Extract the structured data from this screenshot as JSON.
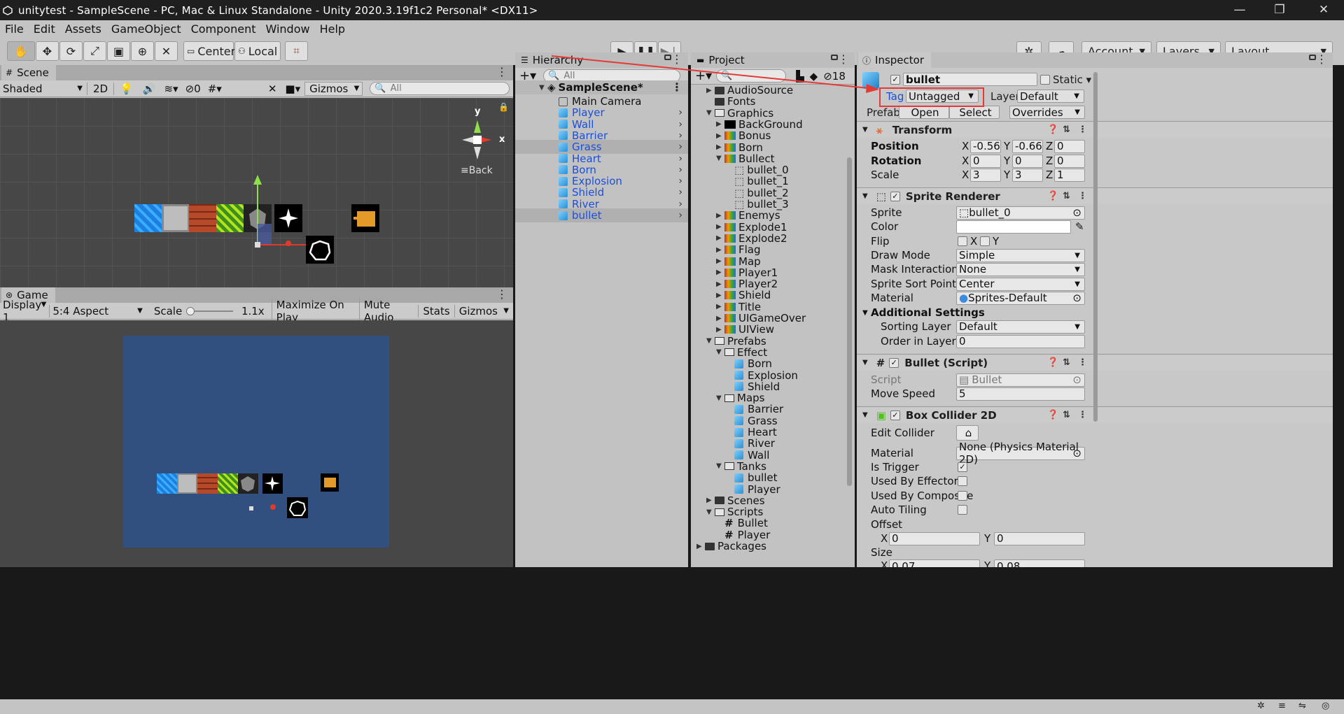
{
  "window": {
    "title": "unitytest - SampleScene - PC, Mac & Linux Standalone - Unity 2020.3.19f1c2 Personal* <DX11>"
  },
  "menu": [
    "File",
    "Edit",
    "Assets",
    "GameObject",
    "Component",
    "Window",
    "Help"
  ],
  "toolbar": {
    "center": "Center",
    "local": "Local",
    "account": "Account",
    "layers": "Layers",
    "layout": "Layout"
  },
  "scene": {
    "tab": "Scene",
    "shading": "Shaded",
    "mode2d": "2D",
    "hidden_count": "0",
    "gizmos": "Gizmos",
    "search_placeholder": "All",
    "gizmo_back": "Back",
    "axis_x": "x",
    "axis_y": "y"
  },
  "game": {
    "tab": "Game",
    "display": "Display 1",
    "aspect": "5:4 Aspect",
    "scale_label": "Scale",
    "scale_value": "1.1x",
    "maximize": "Maximize On Play",
    "mute": "Mute Audio",
    "stats": "Stats",
    "gizmos": "Gizmos"
  },
  "hierarchy": {
    "tab": "Hierarchy",
    "search_placeholder": "All",
    "scene": "SampleScene*",
    "items": [
      {
        "label": "Main Camera",
        "prefab": false
      },
      {
        "label": "Player",
        "prefab": true
      },
      {
        "label": "Wall",
        "prefab": true
      },
      {
        "label": "Barrier",
        "prefab": true
      },
      {
        "label": "Grass",
        "prefab": true
      },
      {
        "label": "Heart",
        "prefab": true
      },
      {
        "label": "Born",
        "prefab": true
      },
      {
        "label": "Explosion",
        "prefab": true
      },
      {
        "label": "Shield",
        "prefab": true
      },
      {
        "label": "River",
        "prefab": true
      },
      {
        "label": "bullet",
        "prefab": true
      }
    ]
  },
  "project": {
    "tab": "Project",
    "hidden_count": "18",
    "items": [
      {
        "label": "AudioSource",
        "depth": 1,
        "kind": "folder",
        "exp": "closed"
      },
      {
        "label": "Fonts",
        "depth": 1,
        "kind": "folder",
        "exp": "none"
      },
      {
        "label": "Graphics",
        "depth": 1,
        "kind": "folder",
        "exp": "open"
      },
      {
        "label": "BackGround",
        "depth": 2,
        "kind": "sprite",
        "exp": "closed"
      },
      {
        "label": "Bonus",
        "depth": 2,
        "kind": "sprite",
        "exp": "closed"
      },
      {
        "label": "Born",
        "depth": 2,
        "kind": "sprite",
        "exp": "closed"
      },
      {
        "label": "Bullect",
        "depth": 2,
        "kind": "sprite",
        "exp": "open"
      },
      {
        "label": "bullet_0",
        "depth": 3,
        "kind": "sub",
        "exp": "none"
      },
      {
        "label": "bullet_1",
        "depth": 3,
        "kind": "sub",
        "exp": "none"
      },
      {
        "label": "bullet_2",
        "depth": 3,
        "kind": "sub",
        "exp": "none"
      },
      {
        "label": "bullet_3",
        "depth": 3,
        "kind": "sub",
        "exp": "none"
      },
      {
        "label": "Enemys",
        "depth": 2,
        "kind": "sprite",
        "exp": "closed"
      },
      {
        "label": "Explode1",
        "depth": 2,
        "kind": "sprite",
        "exp": "closed"
      },
      {
        "label": "Explode2",
        "depth": 2,
        "kind": "sprite",
        "exp": "closed"
      },
      {
        "label": "Flag",
        "depth": 2,
        "kind": "sprite",
        "exp": "closed"
      },
      {
        "label": "Map",
        "depth": 2,
        "kind": "sprite",
        "exp": "closed"
      },
      {
        "label": "Player1",
        "depth": 2,
        "kind": "sprite",
        "exp": "closed"
      },
      {
        "label": "Player2",
        "depth": 2,
        "kind": "sprite",
        "exp": "closed"
      },
      {
        "label": "Shield",
        "depth": 2,
        "kind": "sprite",
        "exp": "closed"
      },
      {
        "label": "Title",
        "depth": 2,
        "kind": "sprite",
        "exp": "closed"
      },
      {
        "label": "UIGameOver",
        "depth": 2,
        "kind": "sprite",
        "exp": "closed"
      },
      {
        "label": "UIView",
        "depth": 2,
        "kind": "sprite",
        "exp": "closed"
      },
      {
        "label": "Prefabs",
        "depth": 1,
        "kind": "folder",
        "exp": "open"
      },
      {
        "label": "Effect",
        "depth": 2,
        "kind": "folder",
        "exp": "open"
      },
      {
        "label": "Born",
        "depth": 3,
        "kind": "prefab",
        "exp": "none"
      },
      {
        "label": "Explosion",
        "depth": 3,
        "kind": "prefab",
        "exp": "none"
      },
      {
        "label": "Shield",
        "depth": 3,
        "kind": "prefab",
        "exp": "none"
      },
      {
        "label": "Maps",
        "depth": 2,
        "kind": "folder",
        "exp": "open"
      },
      {
        "label": "Barrier",
        "depth": 3,
        "kind": "prefab",
        "exp": "none"
      },
      {
        "label": "Grass",
        "depth": 3,
        "kind": "prefab",
        "exp": "none"
      },
      {
        "label": "Heart",
        "depth": 3,
        "kind": "prefab",
        "exp": "none"
      },
      {
        "label": "River",
        "depth": 3,
        "kind": "prefab",
        "exp": "none"
      },
      {
        "label": "Wall",
        "depth": 3,
        "kind": "prefab",
        "exp": "none"
      },
      {
        "label": "Tanks",
        "depth": 2,
        "kind": "folder",
        "exp": "open"
      },
      {
        "label": "bullet",
        "depth": 3,
        "kind": "prefab",
        "exp": "none"
      },
      {
        "label": "Player",
        "depth": 3,
        "kind": "prefab",
        "exp": "none"
      },
      {
        "label": "Scenes",
        "depth": 1,
        "kind": "folder",
        "exp": "closed"
      },
      {
        "label": "Scripts",
        "depth": 1,
        "kind": "folder",
        "exp": "open"
      },
      {
        "label": "Bullet",
        "depth": 2,
        "kind": "script",
        "exp": "none"
      },
      {
        "label": "Player",
        "depth": 2,
        "kind": "script",
        "exp": "none"
      },
      {
        "label": "Packages",
        "depth": 0,
        "kind": "folder",
        "exp": "closed"
      }
    ]
  },
  "inspector": {
    "tab": "Inspector",
    "name": "bullet",
    "static": "Static",
    "tag_label": "Tag",
    "tag": "Untagged",
    "layer_label": "Layer",
    "layer": "Default",
    "prefab_label": "Prefab",
    "open": "Open",
    "select": "Select",
    "overrides": "Overrides",
    "transform": {
      "title": "Transform",
      "position": "Position",
      "rotation": "Rotation",
      "scale": "Scale",
      "pos": [
        "-0.56",
        "-0.66",
        "0"
      ],
      "rot": [
        "0",
        "0",
        "0"
      ],
      "scl": [
        "3",
        "3",
        "1"
      ],
      "x": "X",
      "y": "Y",
      "z": "Z"
    },
    "sprite_renderer": {
      "title": "Sprite Renderer",
      "sprite_label": "Sprite",
      "sprite": "bullet_0",
      "color_label": "Color",
      "flip_label": "Flip",
      "flip_x": "X",
      "flip_y": "Y",
      "draw_mode_label": "Draw Mode",
      "draw_mode": "Simple",
      "mask_label": "Mask Interaction",
      "mask": "None",
      "sort_point_label": "Sprite Sort Point",
      "sort_point": "Center",
      "material_label": "Material",
      "material": "Sprites-Default",
      "additional": "Additional Settings",
      "sorting_layer_label": "Sorting Layer",
      "sorting_layer": "Default",
      "order_label": "Order in Layer",
      "order": "0"
    },
    "bullet_script": {
      "title": "Bullet (Script)",
      "script_label": "Script",
      "script": "Bullet",
      "move_speed_label": "Move Speed",
      "move_speed": "5"
    },
    "box_collider": {
      "title": "Box Collider 2D",
      "edit_label": "Edit Collider",
      "material_label": "Material",
      "material": "None (Physics Material 2D)",
      "trigger_label": "Is Trigger",
      "effector_label": "Used By Effector",
      "composite_label": "Used By Composite",
      "autotiling_label": "Auto Tiling",
      "offset_label": "Offset",
      "offset_x": "0",
      "offset_y": "0",
      "size_label": "Size",
      "x": "X",
      "y": "Y",
      "size_x": "0.07",
      "size_y": "0.08"
    }
  },
  "colors": {
    "annotation_red": "#e53935",
    "game_bg": "#31507f",
    "scene_bg": "#474747",
    "prefab_blue": "#1b4fd8"
  }
}
